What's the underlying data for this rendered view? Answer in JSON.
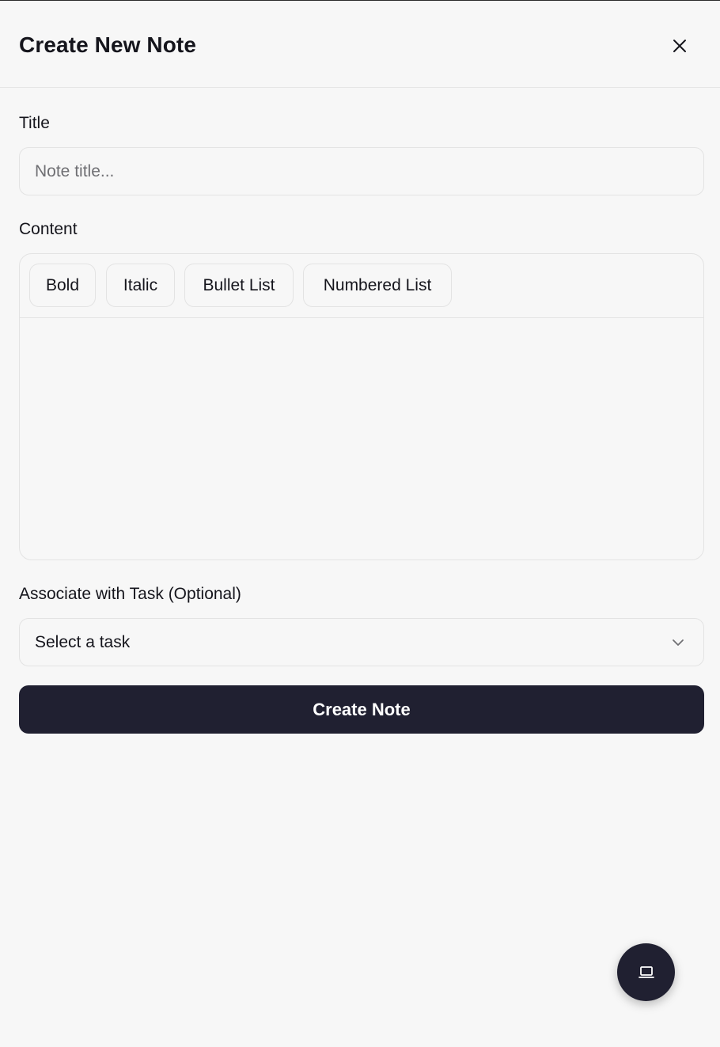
{
  "header": {
    "title": "Create New Note",
    "close_icon": "close-icon"
  },
  "form": {
    "title_label": "Title",
    "title_placeholder": "Note title...",
    "title_value": "",
    "content_label": "Content",
    "toolbar": {
      "bold": "Bold",
      "italic": "Italic",
      "bullet_list": "Bullet List",
      "numbered_list": "Numbered List"
    },
    "content_value": "",
    "task_label": "Associate with Task (Optional)",
    "task_selected": "Select a task",
    "task_select_icon": "chevron-down-icon",
    "submit_label": "Create Note"
  },
  "fab": {
    "icon": "laptop-icon"
  },
  "colors": {
    "background": "#f7f7f7",
    "primary": "#202031",
    "border": "#e3e3e3",
    "text": "#15151c",
    "placeholder": "#6f6f73"
  }
}
